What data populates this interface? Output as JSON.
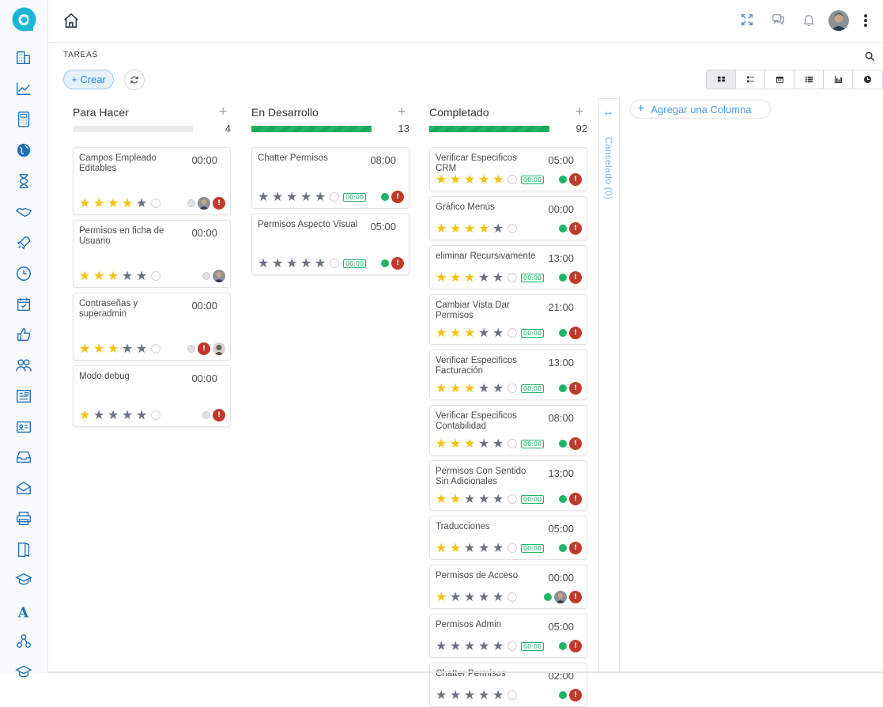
{
  "page": {
    "title": "TAREAS"
  },
  "toolbar": {
    "create_label": "+ Crear"
  },
  "colors": {
    "accent": "#1e88e5",
    "progress": "#1fb466",
    "star_on": "#f4c20d",
    "star_off": "#6b7280",
    "priority": "#c0392b"
  },
  "sidebar_icons": [
    "building-icon",
    "chart-icon",
    "calculator-icon",
    "globe-icon",
    "hourglass-icon",
    "handshake-icon",
    "rocket-icon",
    "clock-icon",
    "calendar-check-icon",
    "thumbs-up-icon",
    "users-icon",
    "id-list-icon",
    "id-card-icon",
    "inbox-icon",
    "envelope-icon",
    "printer-icon",
    "book-icon",
    "graduation-icon",
    "font-icon",
    "network-icon",
    "layers-icon"
  ],
  "view_modes": [
    "kanban",
    "list",
    "calendar",
    "table",
    "graph",
    "activity"
  ],
  "columns": [
    {
      "title": "Para Hacer",
      "count": "4",
      "progress": 0,
      "cards": [
        {
          "name": "Campos Empleado Editables",
          "time": "00:00",
          "stars": 4,
          "timer": false,
          "status": "grey",
          "avatar": true,
          "prio_first": false,
          "height": 86
        },
        {
          "name": "Permisos en ficha de Usuario",
          "time": "00:00",
          "stars": 3,
          "timer": false,
          "status": "grey",
          "avatar": true,
          "prio": false,
          "height": 86
        },
        {
          "name": "Contraseñas y superadmin",
          "time": "00:00",
          "stars": 3,
          "timer": false,
          "status": "grey",
          "avatar": true,
          "prio_first": true,
          "height": 86
        },
        {
          "name": "Modo debug",
          "time": "00:00",
          "stars": 1,
          "timer": false,
          "status": "grey",
          "avatar": false,
          "height": 78
        }
      ]
    },
    {
      "title": "En Desarrollo",
      "count": "13",
      "progress": 1,
      "cards": [
        {
          "name": "Chatter Permisos",
          "time": "08:00",
          "stars": 0,
          "timer": true,
          "timer_text": "00:00",
          "status": "green",
          "avatar": false,
          "height": 78
        },
        {
          "name": "Permisos Aspecto Visual",
          "time": "05:00",
          "stars": 0,
          "timer": true,
          "timer_text": "00:00",
          "status": "green",
          "avatar": false,
          "height": 78
        }
      ]
    },
    {
      "title": "Completado",
      "count": "92",
      "progress": 1,
      "cards": [
        {
          "name": "Verificar Especificos CRM",
          "time": "05:00",
          "stars": 5,
          "timer": true,
          "timer_text": "00:00",
          "status": "green",
          "avatar": false,
          "height": 56
        },
        {
          "name": "Gráfico Menús",
          "time": "00:00",
          "stars": 4,
          "timer": false,
          "status": "green",
          "avatar": false,
          "height": 56
        },
        {
          "name": "eliminar Recursivamente",
          "time": "13:00",
          "stars": 3,
          "timer": true,
          "timer_text": "00:00",
          "status": "green",
          "avatar": false,
          "height": 56
        },
        {
          "name": "Cambiar Vista Dar Permisos",
          "time": "21:00",
          "stars": 3,
          "timer": true,
          "timer_text": "00:00",
          "status": "green",
          "avatar": false,
          "height": 64
        },
        {
          "name": "Verificar Especificos Facturación",
          "time": "13:00",
          "stars": 3,
          "timer": true,
          "timer_text": "00:00",
          "status": "green",
          "avatar": false,
          "height": 64
        },
        {
          "name": "Verificar Especificos Contabilidad",
          "time": "08:00",
          "stars": 3,
          "timer": true,
          "timer_text": "00:00",
          "status": "green",
          "avatar": false,
          "height": 64
        },
        {
          "name": "Permisos Con Sentido Sin Adicionales",
          "time": "13:00",
          "stars": 2,
          "timer": true,
          "timer_text": "00:00",
          "status": "green",
          "avatar": false,
          "height": 64
        },
        {
          "name": "Traducciones",
          "time": "05:00",
          "stars": 2,
          "timer": true,
          "timer_text": "00:00",
          "status": "green",
          "avatar": false,
          "height": 56
        },
        {
          "name": "Permisos de Acceso",
          "time": "00:00",
          "stars": 1,
          "timer": false,
          "status": "green",
          "avatar": true,
          "height": 56
        },
        {
          "name": "Permisos Admin",
          "time": "05:00",
          "stars": 0,
          "timer": true,
          "timer_text": "00:00",
          "status": "green",
          "avatar": false,
          "height": 56
        },
        {
          "name": "Chatter Permisos",
          "time": "02:00",
          "stars": 0,
          "timer": false,
          "status": "green",
          "avatar": false,
          "height": 56
        }
      ]
    }
  ],
  "folded_column": {
    "label": "Cancelado (0)"
  },
  "add_column": {
    "label": "Agregar una Columna"
  }
}
